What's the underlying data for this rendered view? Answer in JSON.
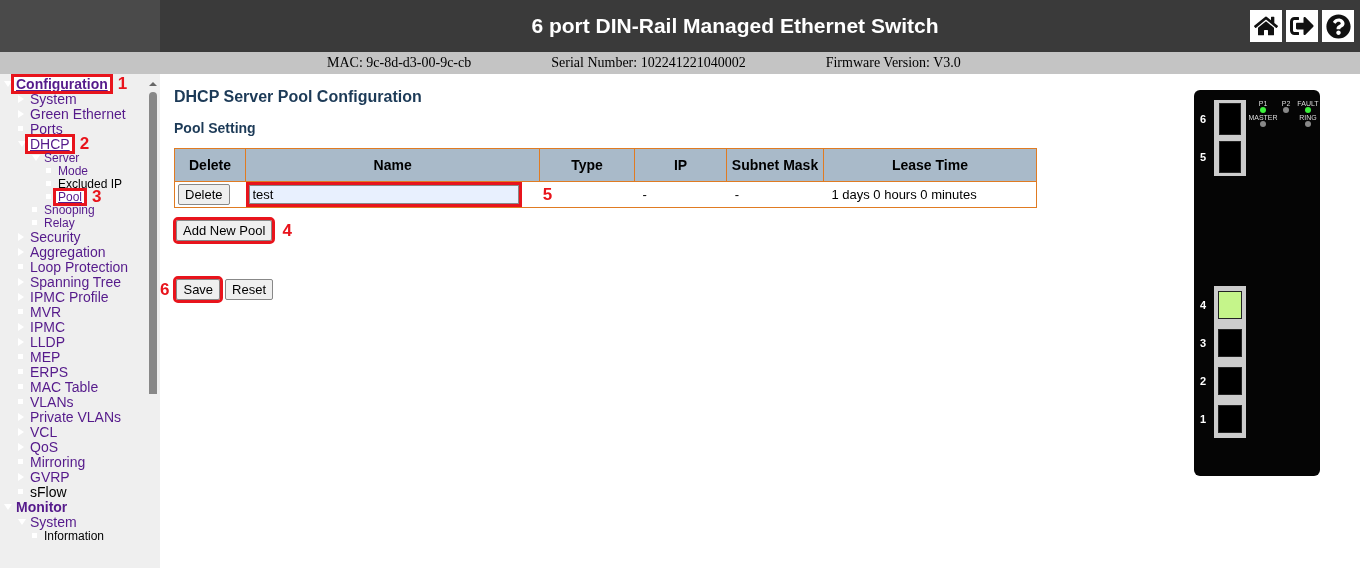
{
  "header": {
    "title": "6 port DIN-Rail Managed Ethernet Switch"
  },
  "info_bar": [
    {
      "label": "MAC: 9c-8d-d3-00-9c-cb"
    },
    {
      "label": "Serial Number: 102241221040002"
    },
    {
      "label": "Firmware Version: V3.0"
    }
  ],
  "sidebar": {
    "items": [
      {
        "label": "Configuration",
        "kind": "section",
        "expanded": true,
        "visited": true,
        "callout": "1",
        "children": [
          {
            "label": "System",
            "kind": "folder",
            "expanded": false,
            "visited": true
          },
          {
            "label": "Green Ethernet",
            "kind": "folder",
            "expanded": false,
            "visited": true
          },
          {
            "label": "Ports",
            "kind": "page",
            "visited": true
          },
          {
            "label": "DHCP",
            "kind": "folder",
            "expanded": true,
            "visited": true,
            "callout": "2",
            "children": [
              {
                "label": "Server",
                "kind": "folder",
                "expanded": true,
                "visited": true,
                "children": [
                  {
                    "label": "Mode",
                    "kind": "page",
                    "visited": true
                  },
                  {
                    "label": "Excluded IP",
                    "kind": "page",
                    "visited": false
                  },
                  {
                    "label": "Pool",
                    "kind": "page",
                    "visited": true,
                    "callout": "3"
                  }
                ]
              },
              {
                "label": "Snooping",
                "kind": "page",
                "visited": true
              },
              {
                "label": "Relay",
                "kind": "page",
                "visited": true
              }
            ]
          },
          {
            "label": "Security",
            "kind": "folder",
            "expanded": false,
            "visited": true
          },
          {
            "label": "Aggregation",
            "kind": "folder",
            "expanded": false,
            "visited": true
          },
          {
            "label": "Loop Protection",
            "kind": "page",
            "visited": true
          },
          {
            "label": "Spanning Tree",
            "kind": "folder",
            "expanded": false,
            "visited": true
          },
          {
            "label": "IPMC Profile",
            "kind": "folder",
            "expanded": false,
            "visited": true
          },
          {
            "label": "MVR",
            "kind": "page",
            "visited": true
          },
          {
            "label": "IPMC",
            "kind": "folder",
            "expanded": false,
            "visited": true
          },
          {
            "label": "LLDP",
            "kind": "folder",
            "expanded": false,
            "visited": true
          },
          {
            "label": "MEP",
            "kind": "page",
            "visited": true
          },
          {
            "label": "ERPS",
            "kind": "page",
            "visited": true
          },
          {
            "label": "MAC Table",
            "kind": "page",
            "visited": true
          },
          {
            "label": "VLANs",
            "kind": "page",
            "visited": true
          },
          {
            "label": "Private VLANs",
            "kind": "folder",
            "expanded": false,
            "visited": true
          },
          {
            "label": "VCL",
            "kind": "folder",
            "expanded": false,
            "visited": true
          },
          {
            "label": "QoS",
            "kind": "folder",
            "expanded": false,
            "visited": true
          },
          {
            "label": "Mirroring",
            "kind": "page",
            "visited": true
          },
          {
            "label": "GVRP",
            "kind": "folder",
            "expanded": false,
            "visited": true
          },
          {
            "label": "sFlow",
            "kind": "page",
            "visited": false
          }
        ]
      },
      {
        "label": "Monitor",
        "kind": "section",
        "expanded": true,
        "visited": true,
        "children": [
          {
            "label": "System",
            "kind": "folder",
            "expanded": true,
            "visited": true,
            "children": [
              {
                "label": "Information",
                "kind": "page",
                "visited": false
              }
            ]
          }
        ]
      }
    ]
  },
  "main": {
    "title": "DHCP Server Pool Configuration",
    "subtitle": "Pool Setting",
    "table": {
      "columns": [
        {
          "label": "Delete"
        },
        {
          "label": "Name"
        },
        {
          "label": "Type"
        },
        {
          "label": "IP"
        },
        {
          "label": "Subnet Mask"
        },
        {
          "label": "Lease Time"
        }
      ],
      "rows": [
        {
          "delete_button": "Delete",
          "name": "test",
          "name_callout": "5",
          "ip": "-",
          "subnet_mask": "-",
          "lease_time": "1 days 0 hours 0 minutes"
        }
      ]
    },
    "add_button": {
      "label": "Add New Pool",
      "callout": "4"
    },
    "buttons": [
      {
        "label": "Save",
        "callout": "6"
      },
      {
        "label": "Reset"
      }
    ]
  },
  "device": {
    "leds": [
      {
        "label": "P1",
        "on": true
      },
      {
        "label": "P2",
        "on": false
      },
      {
        "label": "FAULT",
        "on": true
      },
      {
        "label": "MASTER",
        "on": false
      },
      {
        "label": "RING",
        "on": false
      }
    ],
    "ports": [
      {
        "label": "6",
        "kind": "sfp",
        "link": false
      },
      {
        "label": "5",
        "kind": "sfp",
        "link": false
      },
      {
        "label": "4",
        "kind": "rj45",
        "link": true
      },
      {
        "label": "3",
        "kind": "rj45",
        "link": false
      },
      {
        "label": "2",
        "kind": "rj45",
        "link": false
      },
      {
        "label": "1",
        "kind": "rj45",
        "link": false
      }
    ]
  }
}
